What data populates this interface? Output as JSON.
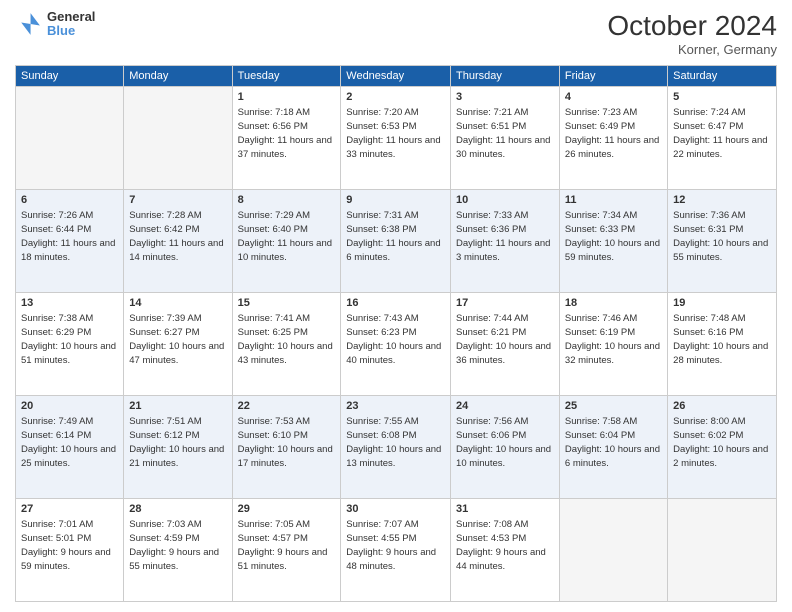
{
  "header": {
    "logo_line1": "General",
    "logo_line2": "Blue",
    "month": "October 2024",
    "location": "Korner, Germany"
  },
  "days_of_week": [
    "Sunday",
    "Monday",
    "Tuesday",
    "Wednesday",
    "Thursday",
    "Friday",
    "Saturday"
  ],
  "weeks": [
    [
      {
        "day": "",
        "info": ""
      },
      {
        "day": "",
        "info": ""
      },
      {
        "day": "1",
        "info": "Sunrise: 7:18 AM\nSunset: 6:56 PM\nDaylight: 11 hours and 37 minutes."
      },
      {
        "day": "2",
        "info": "Sunrise: 7:20 AM\nSunset: 6:53 PM\nDaylight: 11 hours and 33 minutes."
      },
      {
        "day": "3",
        "info": "Sunrise: 7:21 AM\nSunset: 6:51 PM\nDaylight: 11 hours and 30 minutes."
      },
      {
        "day": "4",
        "info": "Sunrise: 7:23 AM\nSunset: 6:49 PM\nDaylight: 11 hours and 26 minutes."
      },
      {
        "day": "5",
        "info": "Sunrise: 7:24 AM\nSunset: 6:47 PM\nDaylight: 11 hours and 22 minutes."
      }
    ],
    [
      {
        "day": "6",
        "info": "Sunrise: 7:26 AM\nSunset: 6:44 PM\nDaylight: 11 hours and 18 minutes."
      },
      {
        "day": "7",
        "info": "Sunrise: 7:28 AM\nSunset: 6:42 PM\nDaylight: 11 hours and 14 minutes."
      },
      {
        "day": "8",
        "info": "Sunrise: 7:29 AM\nSunset: 6:40 PM\nDaylight: 11 hours and 10 minutes."
      },
      {
        "day": "9",
        "info": "Sunrise: 7:31 AM\nSunset: 6:38 PM\nDaylight: 11 hours and 6 minutes."
      },
      {
        "day": "10",
        "info": "Sunrise: 7:33 AM\nSunset: 6:36 PM\nDaylight: 11 hours and 3 minutes."
      },
      {
        "day": "11",
        "info": "Sunrise: 7:34 AM\nSunset: 6:33 PM\nDaylight: 10 hours and 59 minutes."
      },
      {
        "day": "12",
        "info": "Sunrise: 7:36 AM\nSunset: 6:31 PM\nDaylight: 10 hours and 55 minutes."
      }
    ],
    [
      {
        "day": "13",
        "info": "Sunrise: 7:38 AM\nSunset: 6:29 PM\nDaylight: 10 hours and 51 minutes."
      },
      {
        "day": "14",
        "info": "Sunrise: 7:39 AM\nSunset: 6:27 PM\nDaylight: 10 hours and 47 minutes."
      },
      {
        "day": "15",
        "info": "Sunrise: 7:41 AM\nSunset: 6:25 PM\nDaylight: 10 hours and 43 minutes."
      },
      {
        "day": "16",
        "info": "Sunrise: 7:43 AM\nSunset: 6:23 PM\nDaylight: 10 hours and 40 minutes."
      },
      {
        "day": "17",
        "info": "Sunrise: 7:44 AM\nSunset: 6:21 PM\nDaylight: 10 hours and 36 minutes."
      },
      {
        "day": "18",
        "info": "Sunrise: 7:46 AM\nSunset: 6:19 PM\nDaylight: 10 hours and 32 minutes."
      },
      {
        "day": "19",
        "info": "Sunrise: 7:48 AM\nSunset: 6:16 PM\nDaylight: 10 hours and 28 minutes."
      }
    ],
    [
      {
        "day": "20",
        "info": "Sunrise: 7:49 AM\nSunset: 6:14 PM\nDaylight: 10 hours and 25 minutes."
      },
      {
        "day": "21",
        "info": "Sunrise: 7:51 AM\nSunset: 6:12 PM\nDaylight: 10 hours and 21 minutes."
      },
      {
        "day": "22",
        "info": "Sunrise: 7:53 AM\nSunset: 6:10 PM\nDaylight: 10 hours and 17 minutes."
      },
      {
        "day": "23",
        "info": "Sunrise: 7:55 AM\nSunset: 6:08 PM\nDaylight: 10 hours and 13 minutes."
      },
      {
        "day": "24",
        "info": "Sunrise: 7:56 AM\nSunset: 6:06 PM\nDaylight: 10 hours and 10 minutes."
      },
      {
        "day": "25",
        "info": "Sunrise: 7:58 AM\nSunset: 6:04 PM\nDaylight: 10 hours and 6 minutes."
      },
      {
        "day": "26",
        "info": "Sunrise: 8:00 AM\nSunset: 6:02 PM\nDaylight: 10 hours and 2 minutes."
      }
    ],
    [
      {
        "day": "27",
        "info": "Sunrise: 7:01 AM\nSunset: 5:01 PM\nDaylight: 9 hours and 59 minutes."
      },
      {
        "day": "28",
        "info": "Sunrise: 7:03 AM\nSunset: 4:59 PM\nDaylight: 9 hours and 55 minutes."
      },
      {
        "day": "29",
        "info": "Sunrise: 7:05 AM\nSunset: 4:57 PM\nDaylight: 9 hours and 51 minutes."
      },
      {
        "day": "30",
        "info": "Sunrise: 7:07 AM\nSunset: 4:55 PM\nDaylight: 9 hours and 48 minutes."
      },
      {
        "day": "31",
        "info": "Sunrise: 7:08 AM\nSunset: 4:53 PM\nDaylight: 9 hours and 44 minutes."
      },
      {
        "day": "",
        "info": ""
      },
      {
        "day": "",
        "info": ""
      }
    ]
  ]
}
